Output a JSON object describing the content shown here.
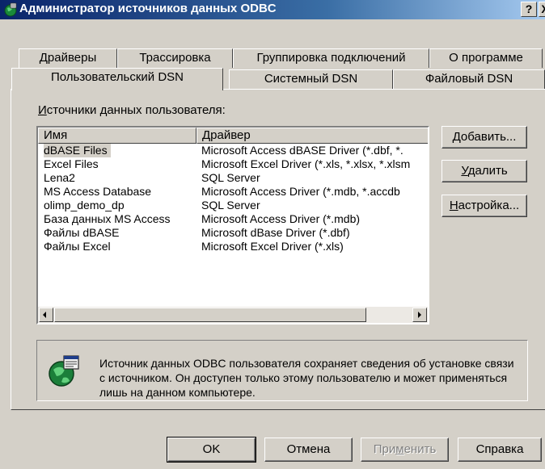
{
  "window": {
    "title": "Администратор источников данных ODBC",
    "help_button": "?",
    "close_button": "X"
  },
  "tabs_top": [
    {
      "label": "Драйверы"
    },
    {
      "label": "Трассировка"
    },
    {
      "label": "Группировка подключений"
    },
    {
      "label": "О программе"
    }
  ],
  "tabs_bottom": [
    {
      "label": "Пользовательский DSN",
      "active": true
    },
    {
      "label": "Системный DSN"
    },
    {
      "label": "Файловый DSN"
    }
  ],
  "group": {
    "label_mnemonic": "И",
    "label_rest": "сточники данных пользователя:"
  },
  "list": {
    "columns": [
      "Имя",
      "Драйвер"
    ],
    "rows": [
      {
        "name": "dBASE Files",
        "driver": "Microsoft Access dBASE Driver (*.dbf, *."
      },
      {
        "name": "Excel Files",
        "driver": "Microsoft Excel Driver (*.xls, *.xlsx, *.xlsm"
      },
      {
        "name": "Lena2",
        "driver": "SQL Server"
      },
      {
        "name": "MS Access Database",
        "driver": "Microsoft Access Driver (*.mdb, *.accdb"
      },
      {
        "name": "olimp_demo_dp",
        "driver": "SQL Server"
      },
      {
        "name": "База данных MS Access",
        "driver": "Microsoft Access Driver (*.mdb)"
      },
      {
        "name": "Файлы dBASE",
        "driver": "Microsoft dBase Driver (*.dbf)"
      },
      {
        "name": "Файлы Excel",
        "driver": "Microsoft Excel Driver (*.xls)"
      }
    ]
  },
  "side_buttons": {
    "add": {
      "mnemonic": "Д",
      "rest": "обавить..."
    },
    "remove": {
      "mnemonic": "У",
      "rest": "далить"
    },
    "configure": {
      "mnemonic": "Н",
      "rest": "астройка..."
    }
  },
  "info": {
    "text": "Источник данных ODBC пользователя сохраняет сведения об установке связи с источником.  Он доступен только этому пользователю и может применяться лишь на данном компьютере."
  },
  "bottom_buttons": {
    "ok": "OK",
    "cancel": "Отмена",
    "apply_pre": "При",
    "apply_mnemonic": "м",
    "apply_post": "енить",
    "help": "Справка"
  }
}
